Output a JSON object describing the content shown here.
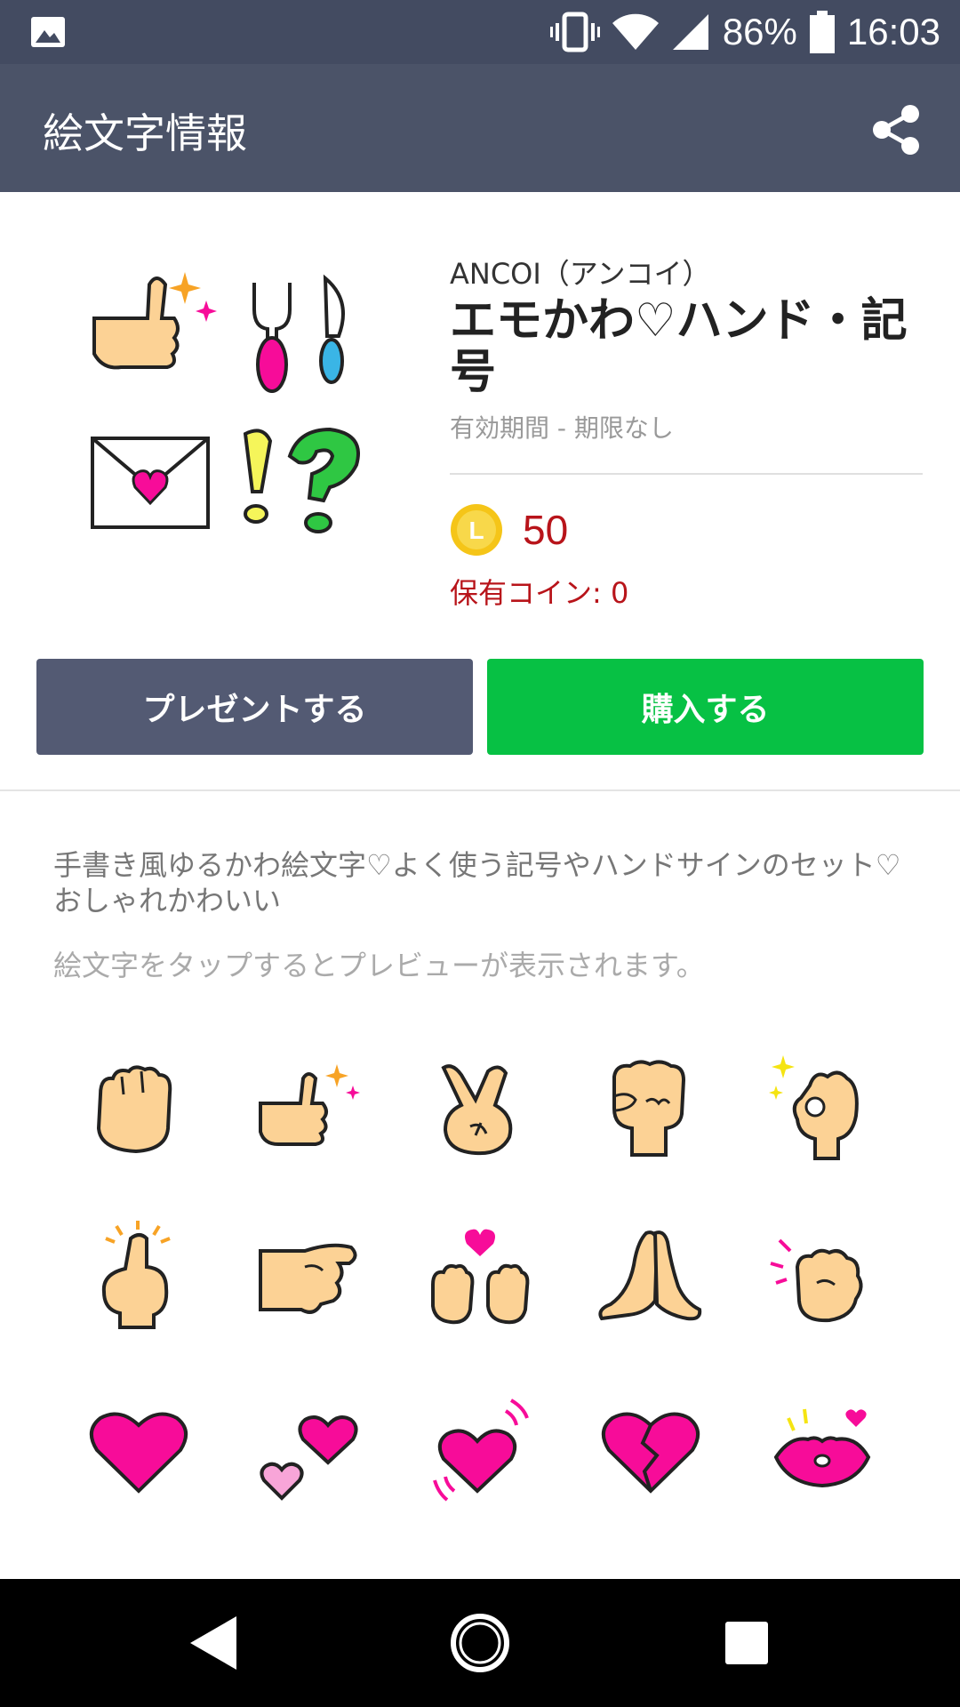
{
  "status_bar": {
    "battery": "86%",
    "time": "16:03"
  },
  "header": {
    "title": "絵文字情報"
  },
  "product": {
    "author": "ANCOI（アンコイ）",
    "title": "エモかわ♡ハンド・記号",
    "validity": "有効期間 - 期限なし",
    "price": "50",
    "owned_coins": "保有コイン: 0",
    "coin_icon_letter": "L"
  },
  "buttons": {
    "present": "プレゼントする",
    "buy": "購入する"
  },
  "description": "手書き風ゆるかわ絵文字♡よく使う記号やハンドサインのセット♡おしゃれかわいい",
  "hint": "絵文字をタップするとプレビューが表示されます。",
  "emojis": [
    "fist-emoji",
    "thumbs-up-sparkle-emoji",
    "peace-sign-emoji",
    "clenched-fist-emoji",
    "ok-sign-sparkle-emoji",
    "pointing-up-emoji",
    "pointing-right-emoji",
    "heart-hands-emoji",
    "praying-hands-emoji",
    "knock-fist-emoji",
    "pink-heart-emoji",
    "two-hearts-emoji",
    "beating-heart-emoji",
    "broken-heart-emoji",
    "kiss-lips-emoji"
  ],
  "colors": {
    "status_bar": "#434b61",
    "header": "#4b5368",
    "present_button": "#535a73",
    "buy_button": "#07c144",
    "price": "#b8141a",
    "skin": "#fcd295",
    "heart": "#f70c99"
  }
}
